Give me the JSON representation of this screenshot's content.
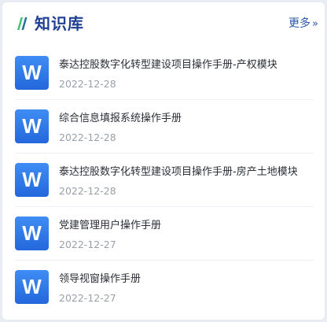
{
  "header": {
    "title": "知识库",
    "more_label": "更多",
    "more_icon": "double-chevron-right-icon",
    "accent_colors": [
      "#3ec36b",
      "#1f3f93"
    ]
  },
  "documents": [
    {
      "icon_letter": "W",
      "title": "泰达控股数字化转型建设项目操作手册-产权模块",
      "date": "2022-12-28"
    },
    {
      "icon_letter": "W",
      "title": "综合信息填报系统操作手册",
      "date": "2022-12-28"
    },
    {
      "icon_letter": "W",
      "title": "泰达控股数字化转型建设项目操作手册-房产土地模块",
      "date": "2022-12-28"
    },
    {
      "icon_letter": "W",
      "title": "党建管理用户操作手册",
      "date": "2022-12-27"
    },
    {
      "icon_letter": "W",
      "title": "领导视窗操作手册",
      "date": "2022-12-27"
    }
  ]
}
